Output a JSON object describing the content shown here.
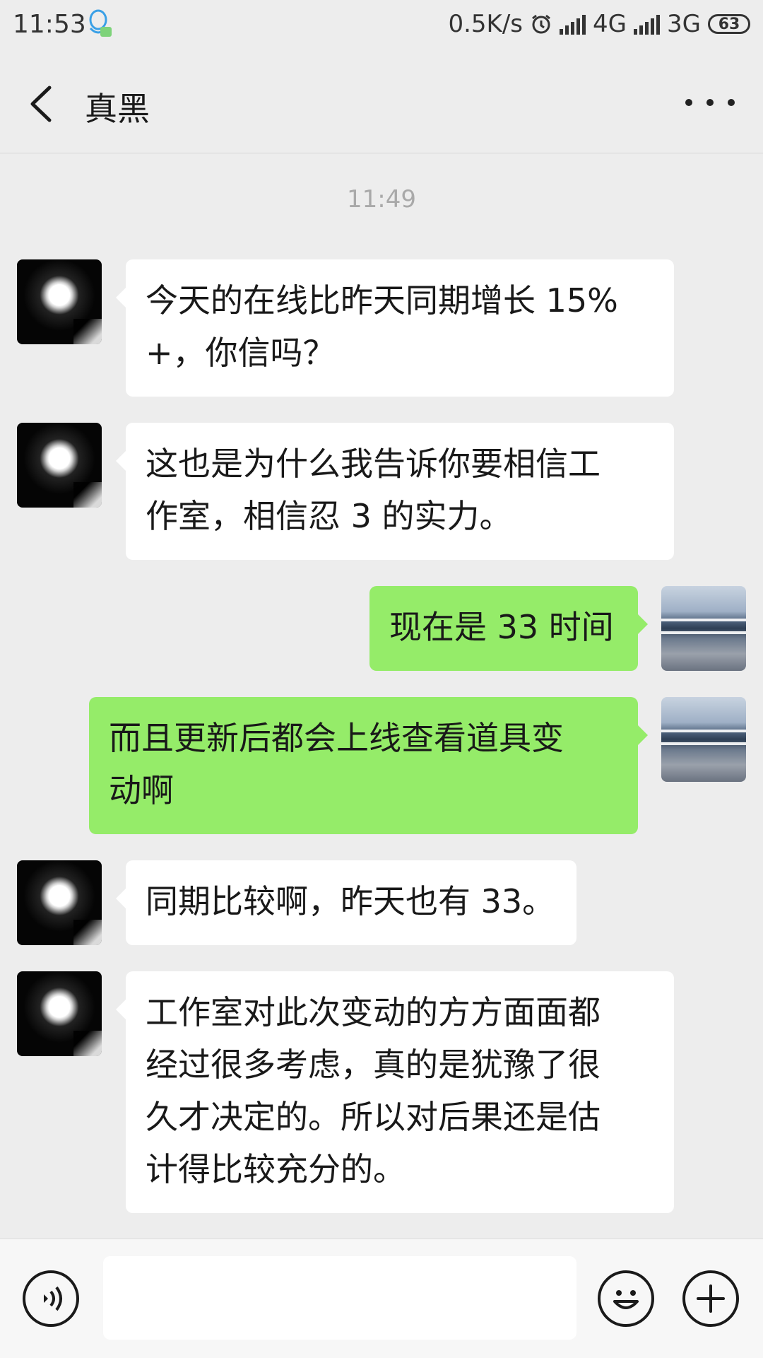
{
  "status_bar": {
    "time": "11:53",
    "net_speed": "0.5K/s",
    "network_1": "4G",
    "network_2": "3G",
    "battery": "63",
    "icons": [
      "qq-icon",
      "alarm-icon",
      "signal-icon",
      "battery-icon"
    ]
  },
  "header": {
    "title": "真黑",
    "back_icon": "chevron-left-icon",
    "more_icon": "more-dots-icon"
  },
  "chat": {
    "timestamp": "11:49",
    "messages": [
      {
        "side": "left",
        "text": "今天的在线比昨天同期增长 15%\n+，你信吗？"
      },
      {
        "side": "left",
        "text": "这也是为什么我告诉你要相信工\n作室，相信忍 3 的实力。"
      },
      {
        "side": "right",
        "text": "现在是 33 时间"
      },
      {
        "side": "right",
        "text": "而且更新后都会上线查看道具变\n动啊"
      },
      {
        "side": "left",
        "text": "同期比较啊，昨天也有 33。"
      },
      {
        "side": "left",
        "text": "工作室对此次变动的方方面面都\n经过很多考虑，真的是犹豫了很\n久才决定的。所以对后果还是估\n计得比较充分的。"
      }
    ]
  },
  "input_bar": {
    "input_value": "",
    "icons": [
      "voice-icon",
      "emoji-icon",
      "plus-icon"
    ]
  }
}
